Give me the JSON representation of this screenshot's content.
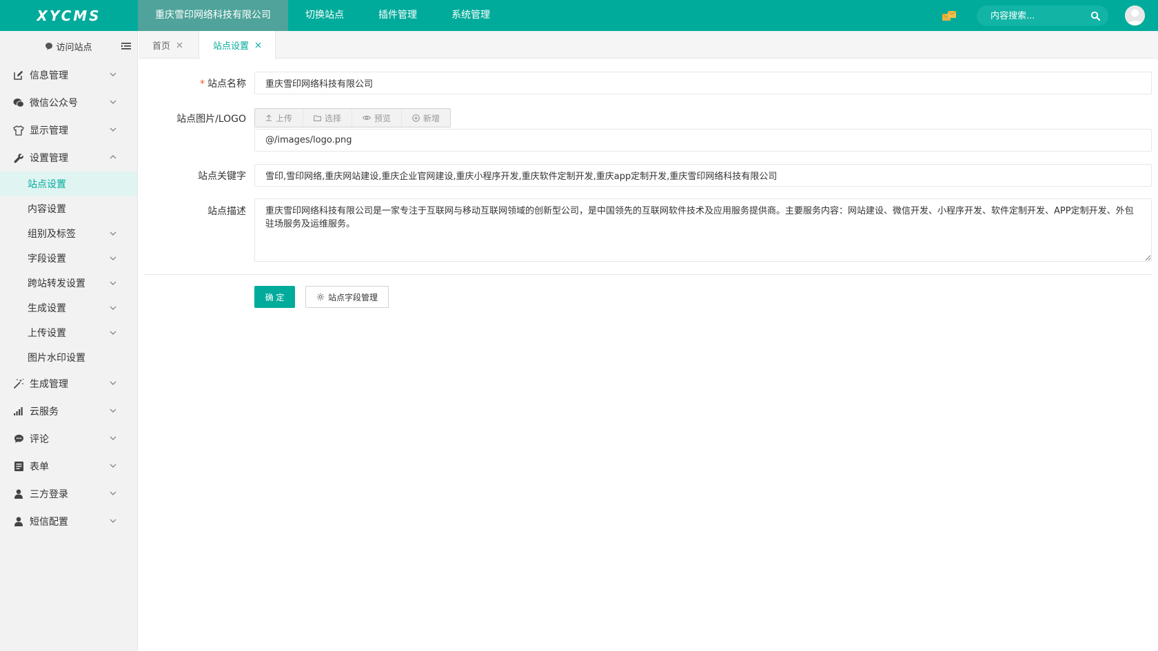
{
  "header": {
    "logo": "XYCMS",
    "nav": [
      "重庆雪印网络科技有限公司",
      "切换站点",
      "插件管理",
      "系统管理"
    ],
    "search_placeholder": "内容搜索...",
    "colors": {
      "brand": "#00ab9b",
      "mail": "#e7b33f"
    }
  },
  "sidebar": {
    "visit_site": "访问站点",
    "menu_top": [
      {
        "label": "信息管理",
        "icon": "edit-icon"
      },
      {
        "label": "微信公众号",
        "icon": "wechat-icon"
      },
      {
        "label": "显示管理",
        "icon": "shirt-icon"
      },
      {
        "label": "设置管理",
        "icon": "wrench-icon"
      }
    ],
    "sub_items": [
      {
        "label": "站点设置",
        "chevron": false,
        "active": true
      },
      {
        "label": "内容设置",
        "chevron": false
      },
      {
        "label": "组别及标签",
        "chevron": true
      },
      {
        "label": "字段设置",
        "chevron": true
      },
      {
        "label": "跨站转发设置",
        "chevron": true
      },
      {
        "label": "生成设置",
        "chevron": true
      },
      {
        "label": "上传设置",
        "chevron": true
      },
      {
        "label": "图片水印设置",
        "chevron": false
      }
    ],
    "menu_bottom": [
      {
        "label": "生成管理",
        "icon": "magic-wand-icon"
      },
      {
        "label": "云服务",
        "icon": "bar-chart-icon"
      },
      {
        "label": "评论",
        "icon": "comment-icon"
      },
      {
        "label": "表单",
        "icon": "form-icon"
      },
      {
        "label": "三方登录",
        "icon": "user-icon"
      },
      {
        "label": "短信配置",
        "icon": "user-icon"
      }
    ]
  },
  "tabs": [
    "首页",
    "站点设置"
  ],
  "form": {
    "site_name": {
      "label": "站点名称",
      "value": "重庆雪印网络科技有限公司"
    },
    "logo": {
      "label": "站点图片/LOGO",
      "buttons": [
        "上传",
        "选择",
        "预览",
        "新增"
      ],
      "value": "@/images/logo.png"
    },
    "keywords": {
      "label": "站点关键字",
      "value": "雪印,雪印网络,重庆网站建设,重庆企业官网建设,重庆小程序开发,重庆软件定制开发,重庆app定制开发,重庆雪印网络科技有限公司"
    },
    "description": {
      "label": "站点描述",
      "value": "重庆雪印网络科技有限公司是一家专注于互联网与移动互联网领域的创新型公司，是中国领先的互联网软件技术及应用服务提供商。主要服务内容：网站建设、微信开发、小程序开发、软件定制开发、APP定制开发、外包驻场服务及运维服务。"
    },
    "submit_label": "确 定",
    "field_manage_label": "站点字段管理"
  }
}
